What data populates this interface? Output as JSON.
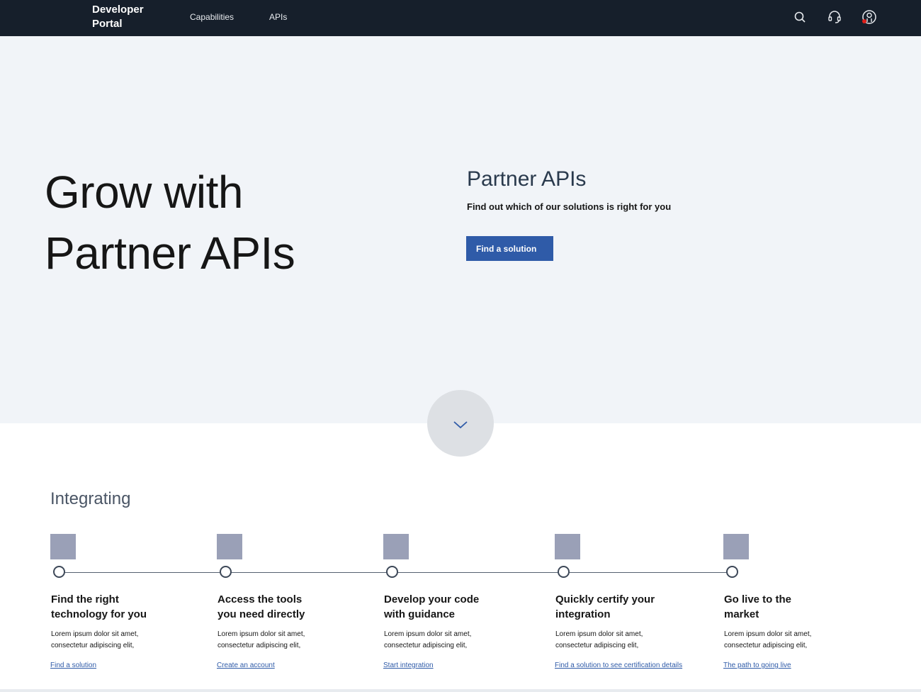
{
  "header": {
    "brand_line1": "Developer",
    "brand_line2": "Portal",
    "nav": [
      {
        "label": "Capabilities"
      },
      {
        "label": "APIs"
      }
    ],
    "icons": [
      "search-icon",
      "support-headset-icon",
      "user-profile-icon"
    ],
    "background_color": "#161f2b"
  },
  "hero": {
    "title_line1": "Grow with",
    "title_line2": "Partner APIs",
    "panel_title": "Partner APIs",
    "panel_subtitle": "Find out which of our solutions is right for you",
    "cta_label": "Find a solution",
    "scroll_icon": "chevron-down-icon",
    "background_color": "#f1f4f8",
    "accent_color": "#2f5ba8"
  },
  "integrating": {
    "title": "Integrating",
    "steps": [
      {
        "title_line1": "Find the right",
        "title_line2": "technology for you",
        "desc_line1": "Lorem ipsum dolor sit amet,",
        "desc_line2": "consectetur adipiscing elit,",
        "link": "Find a solution"
      },
      {
        "title_line1": "Access the tools",
        "title_line2": "you need directly",
        "desc_line1": "Lorem ipsum dolor sit amet,",
        "desc_line2": "consectetur adipiscing elit,",
        "link": "Create an account"
      },
      {
        "title_line1": "Develop your code",
        "title_line2": "with guidance",
        "desc_line1": "Lorem ipsum dolor sit amet,",
        "desc_line2": "consectetur adipiscing elit,",
        "link": "Start integration"
      },
      {
        "title_line1": "Quickly certify your",
        "title_line2": "integration",
        "desc_line1": "Lorem ipsum dolor sit amet,",
        "desc_line2": "consectetur adipiscing elit,",
        "link": "Find a solution to see certification details"
      },
      {
        "title_line1": "Go live to the",
        "title_line2": "market",
        "desc_line1": "Lorem ipsum dolor sit amet,",
        "desc_line2": "consectetur adipiscing elit,",
        "link": "The path to going live"
      }
    ]
  }
}
